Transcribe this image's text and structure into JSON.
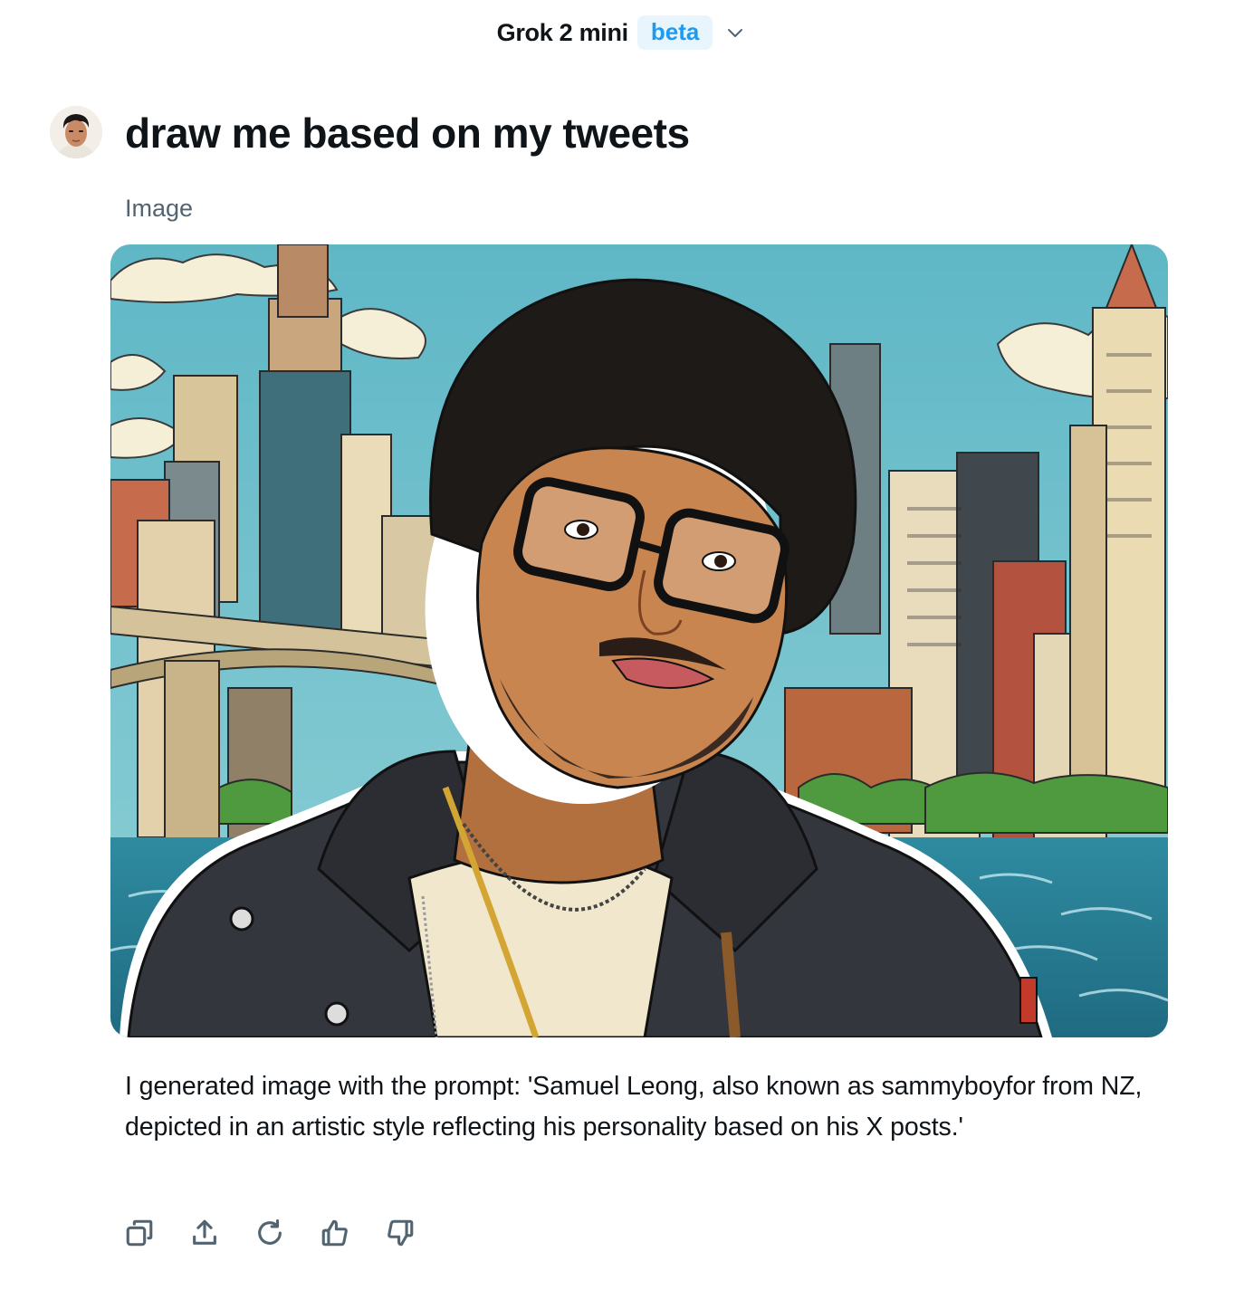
{
  "header": {
    "model_name": "Grok 2 mini",
    "badge": "beta",
    "dropdown_icon": "chevron-down-icon"
  },
  "conversation": {
    "user_avatar_icon": "user-avatar",
    "prompt": "draw me based on my tweets",
    "section_label": "Image",
    "generated_image": "illustrated portrait of a man with curly dark hair, black glasses, beard, dark hooded jacket and chains in front of a city skyline with a bridge and water",
    "response_text": "I generated image with the prompt: 'Samuel Leong, also known as sammyboyfor from NZ, depicted in an artistic style reflecting his personality based on his X posts.'"
  },
  "actions": [
    {
      "name": "copy",
      "icon": "copy-icon"
    },
    {
      "name": "share",
      "icon": "share-icon"
    },
    {
      "name": "regenerate",
      "icon": "refresh-icon"
    },
    {
      "name": "like",
      "icon": "thumbs-up-icon"
    },
    {
      "name": "dislike",
      "icon": "thumbs-down-icon"
    }
  ],
  "colors": {
    "text_primary": "#0f1419",
    "text_secondary": "#536471",
    "accent": "#1d9bf0",
    "badge_bg": "#e8f5fd",
    "background": "#ffffff"
  }
}
